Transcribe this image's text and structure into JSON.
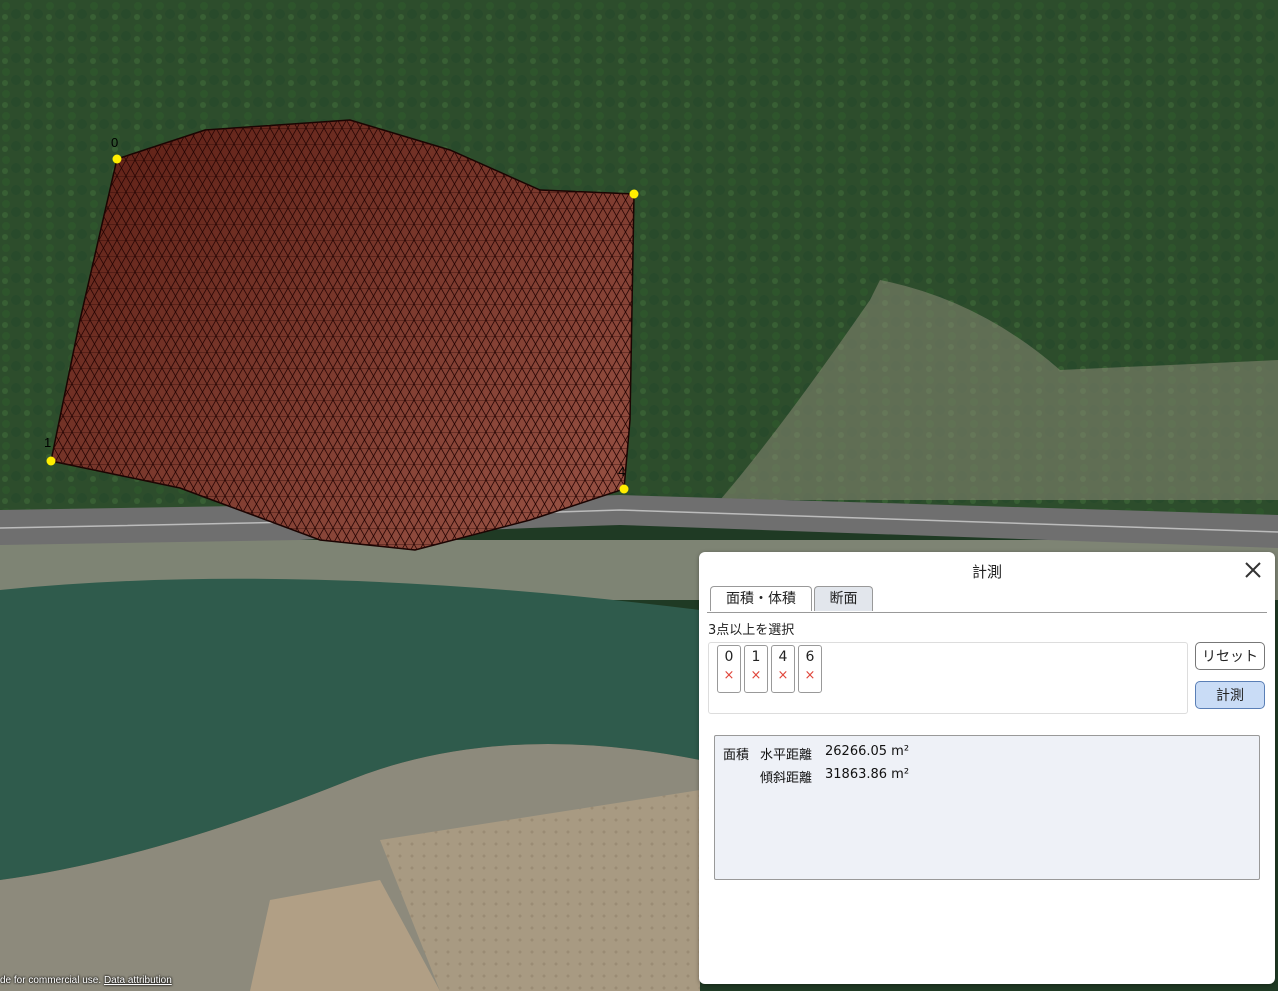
{
  "map": {
    "vertex_labels": [
      "0",
      "1",
      "4"
    ],
    "vertex_color": "#ffee00",
    "polygon_color": "#7a1e10",
    "attribution_text": "de for commercial use.",
    "attribution_link": "Data attribution"
  },
  "panel": {
    "title": "計測",
    "close_icon": "close-icon",
    "tabs": [
      {
        "label": "面積・体積",
        "active": true
      },
      {
        "label": "断面",
        "active": false
      }
    ],
    "instruction": "3点以上を選択",
    "points": [
      {
        "label": "0",
        "remove": "×"
      },
      {
        "label": "1",
        "remove": "×"
      },
      {
        "label": "4",
        "remove": "×"
      },
      {
        "label": "6",
        "remove": "×"
      }
    ],
    "reset_label": "リセット",
    "measure_label": "計測",
    "result": {
      "heading": "面積",
      "horizontal_label": "水平距離",
      "horizontal_value": "26266.05 m²",
      "slope_label": "傾斜距離",
      "slope_value": "31863.86 m²"
    }
  }
}
